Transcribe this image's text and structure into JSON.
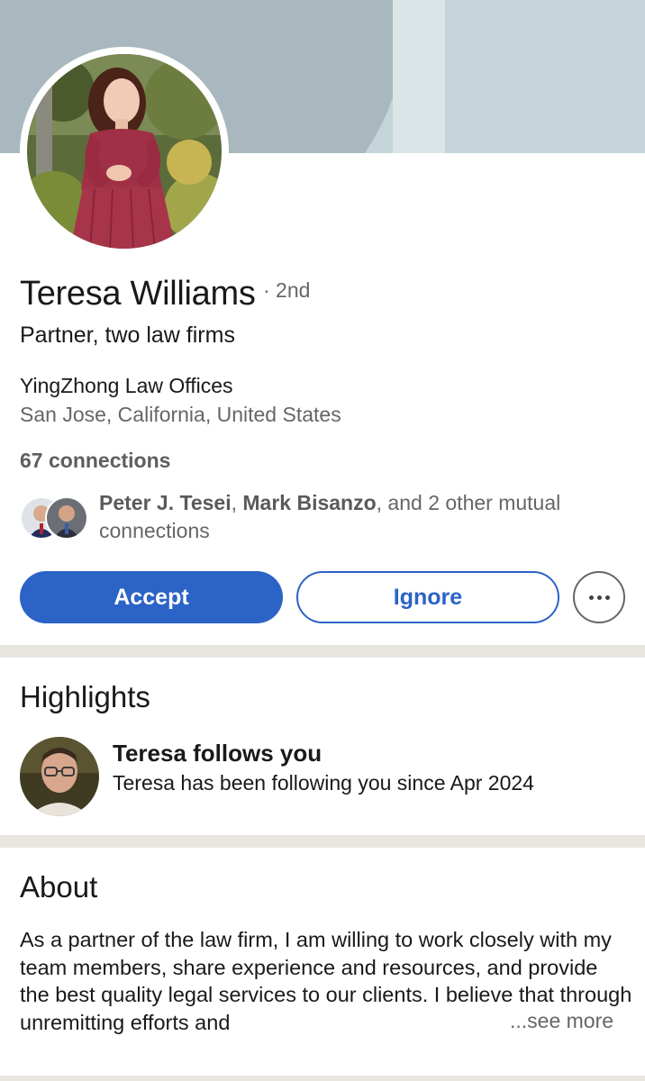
{
  "profile": {
    "name": "Teresa Williams",
    "degree": "· 2nd",
    "headline": "Partner, two law firms",
    "company": "YingZhong Law Offices",
    "location": "San Jose, California, United States",
    "connections": "67 connections",
    "mutual": {
      "name1": "Peter J. Tesei",
      "sep": ", ",
      "name2": "Mark Bisanzo",
      "rest": ", and 2 other mutual connections"
    }
  },
  "actions": {
    "accept": "Accept",
    "ignore": "Ignore",
    "more_icon": "more-horizontal-icon"
  },
  "highlights": {
    "title": "Highlights",
    "item_title": "Teresa follows you",
    "item_sub": "Teresa has been following you since Apr 2024"
  },
  "about": {
    "title": "About",
    "text": "As a partner of the law firm, I am willing to work closely with my team members, share experience and resources, and provide the best quality legal services to our clients. I believe that through unremitting efforts and",
    "see_more": "...see more"
  },
  "colors": {
    "accent": "#2b63c6",
    "banner": "#c5d4d9",
    "divider": "#e9e5df"
  }
}
